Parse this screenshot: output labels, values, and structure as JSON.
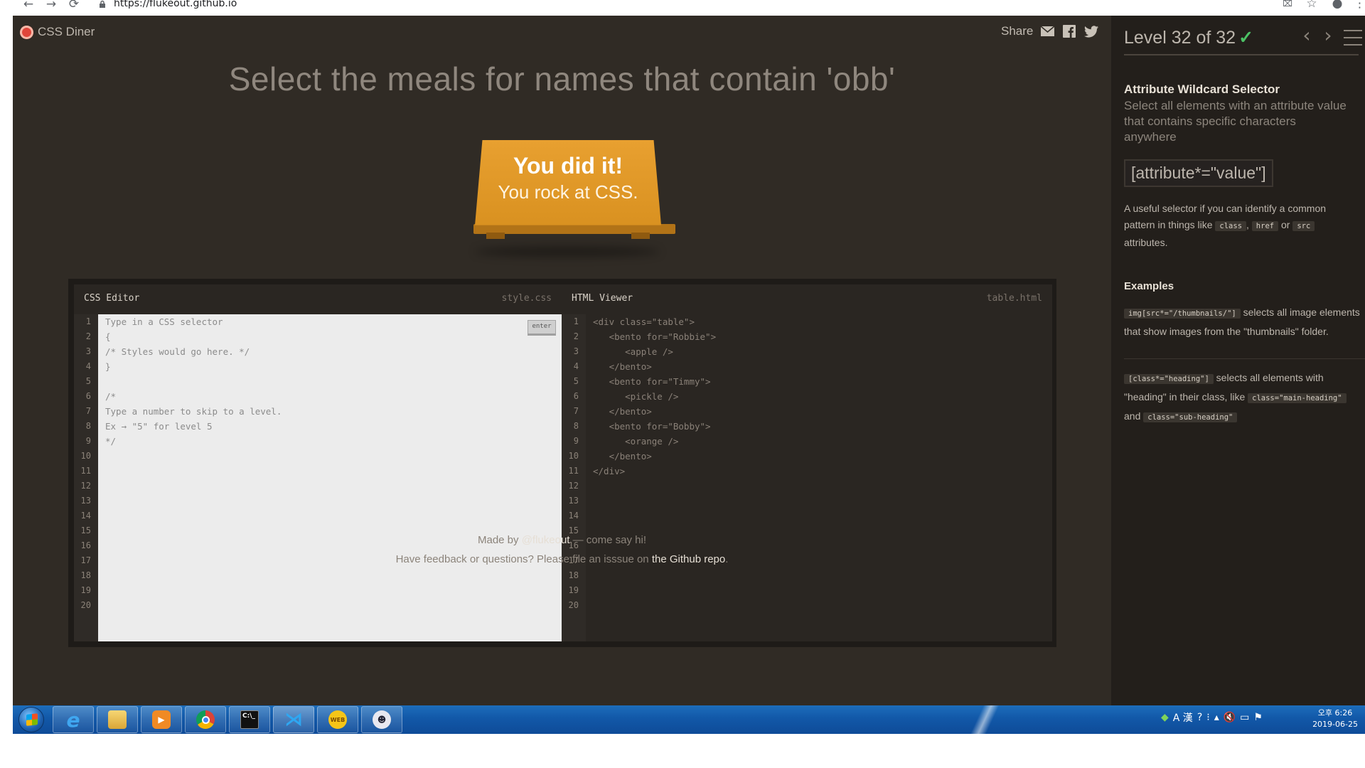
{
  "browser": {
    "url": "https://flukeout.github.io"
  },
  "app": {
    "logo_text": "CSS Diner",
    "share_label": "Share",
    "order_text": "Select the meals for names that contain 'obb'",
    "success_title": "You did it!",
    "success_subtitle": "You rock at CSS."
  },
  "css_editor": {
    "title": "CSS Editor",
    "file": "style.css",
    "enter_label": "enter",
    "lines": [
      "Type in a CSS selector",
      "{",
      "/* Styles would go here. */",
      "}",
      "",
      "/*",
      "Type a number to skip to a level.",
      "Ex → \"5\" for level 5",
      "*/",
      "",
      "",
      "",
      "",
      "",
      "",
      "",
      "",
      "",
      "",
      ""
    ],
    "line_numbers": [
      "1",
      "2",
      "3",
      "4",
      "5",
      "6",
      "7",
      "8",
      "9",
      "10",
      "11",
      "12",
      "13",
      "14",
      "15",
      "16",
      "17",
      "18",
      "19",
      "20"
    ]
  },
  "html_viewer": {
    "title": "HTML Viewer",
    "file": "table.html",
    "lines": [
      "<div class=\"table\">",
      "   <bento for=\"Robbie\">",
      "      <apple />",
      "   </bento>",
      "   <bento for=\"Timmy\">",
      "      <pickle />",
      "   </bento>",
      "   <bento for=\"Bobby\">",
      "      <orange />",
      "   </bento>",
      "</div>",
      "",
      "",
      "",
      "",
      "",
      "",
      "",
      "",
      ""
    ],
    "line_numbers": [
      "1",
      "2",
      "3",
      "4",
      "5",
      "6",
      "7",
      "8",
      "9",
      "10",
      "11",
      "12",
      "13",
      "14",
      "15",
      "16",
      "17",
      "18",
      "19",
      "20"
    ]
  },
  "footer": {
    "line1_prefix": "Made by ",
    "line1_link": "@flukeout",
    "line1_suffix": " — come say hi!",
    "line2_prefix": "Have feedback or questions? Please file an isssue on ",
    "line2_link": "the Github repo",
    "line2_suffix": "."
  },
  "sidebar": {
    "level_text": "Level 32 of 32",
    "check": "✓",
    "selector_name": "Attribute Wildcard Selector",
    "selector_title": "Select all elements with an attribute value that contains specific characters anywhere",
    "syntax": "[attribute*=\"value\"]",
    "hint_part1": "A useful selector if you can identify a common pattern in things like ",
    "hint_tag1": "class",
    "hint_sep1": ", ",
    "hint_tag2": "href",
    "hint_sep2": " or ",
    "hint_tag3": "src",
    "hint_part2": " attributes.",
    "examples_title": "Examples",
    "ex1_code": "img[src*=\"/thumbnails/\"]",
    "ex1_text": " selects all image elements that show images from the \"thumbnails\" folder.",
    "ex2_code": "[class*=\"heading\"]",
    "ex2_text1": " selects all elements with \"heading\" in their class, like ",
    "ex2_code2": "class=\"main-heading\"",
    "ex2_text2": " and ",
    "ex2_code3": "class=\"sub-heading\""
  },
  "taskbar": {
    "apps": [
      "internet-explorer",
      "file-explorer",
      "media-player",
      "chrome",
      "command-prompt",
      "visual-studio-code",
      "web4he",
      "game-app"
    ],
    "tray_lang": "A 漢",
    "time": "오후 6:26",
    "date": "2019-06-25"
  }
}
